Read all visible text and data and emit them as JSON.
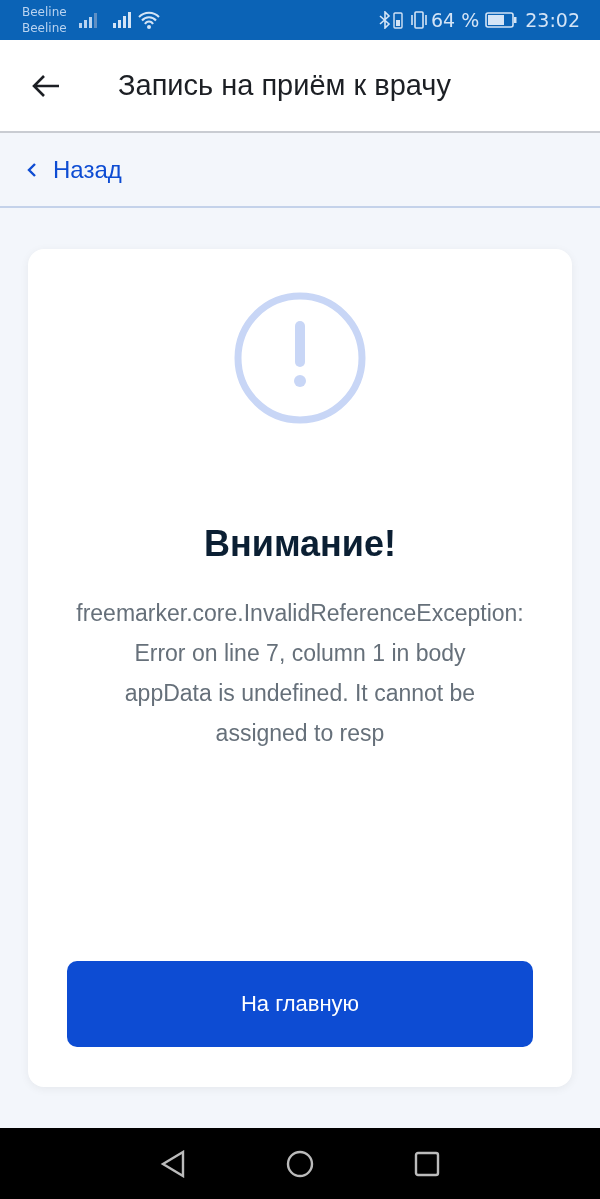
{
  "status_bar": {
    "carriers": [
      "Beeline",
      "Beeline"
    ],
    "battery": "64 %",
    "time": "23:02"
  },
  "header": {
    "title": "Запись на приём к врачу"
  },
  "back_link": {
    "label": "Назад"
  },
  "card": {
    "title": "Внимание!",
    "message": [
      "freemarker.core.InvalidReferenceException:",
      "Error on line 7, column 1 in body",
      "appData is undefined. It cannot be",
      "assigned to resp"
    ],
    "button": "На главную"
  }
}
